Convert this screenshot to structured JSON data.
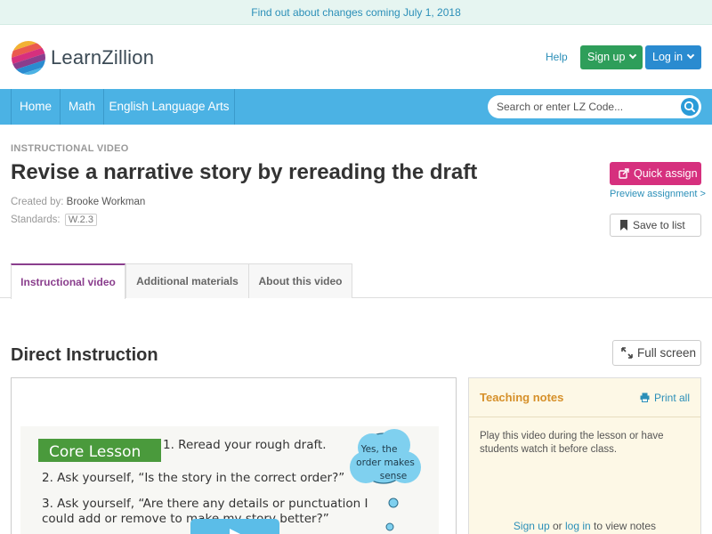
{
  "banner": {
    "text": "Find out about changes coming July 1, 2018"
  },
  "header": {
    "brand": "LearnZillion",
    "help": "Help",
    "signup": "Sign up",
    "login": "Log in"
  },
  "nav": {
    "items": [
      "Home",
      "Math",
      "English Language Arts"
    ],
    "search_placeholder": "Search or enter LZ Code..."
  },
  "page": {
    "kicker": "INSTRUCTIONAL VIDEO",
    "title": "Revise a narrative story by rereading the draft",
    "created_by_label": "Created by:",
    "created_by": "Brooke Workman",
    "standards_label": "Standards:",
    "standard": "W.2.3"
  },
  "actions": {
    "quick_assign": "Quick assign",
    "preview": "Preview assignment >",
    "save": "Save to list"
  },
  "tabs": [
    "Instructional video",
    "Additional materials",
    "About this video"
  ],
  "section": {
    "title": "Direct Instruction",
    "full_screen": "Full screen"
  },
  "video": {
    "core_lesson": "Core Lesson",
    "step1": "1.  Reread your rough draft.",
    "step2": "2. Ask yourself, “Is the story in the correct order?”",
    "step3a": "3. Ask yourself, “Are there any details or punctuation I",
    "step3b": "could add or remove to make my story better?”",
    "bubble1": "Yes, the",
    "bubble2": "order makes",
    "bubble3": "sense"
  },
  "notes": {
    "title": "Teaching notes",
    "print": "Print all",
    "body": "Play this video during the lesson or have students watch it before class.",
    "signup": "Sign up",
    "or": "or",
    "login": "log in",
    "tail": "to view notes"
  },
  "colors": {
    "nav": "#4bb2e4",
    "signup": "#2e9e5a",
    "login": "#2a8bd0",
    "quick_assign": "#d6307e",
    "tab_active": "#8a3e8d",
    "core_lesson": "#4a9a3c",
    "notes_title": "#d6902a"
  }
}
